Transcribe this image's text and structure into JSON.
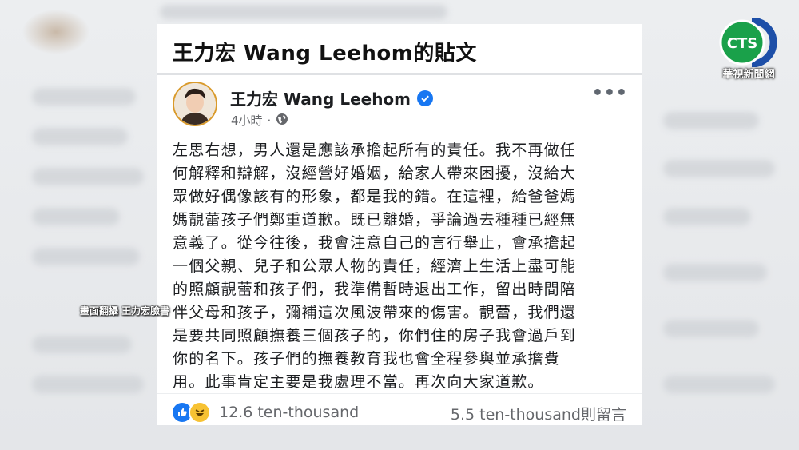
{
  "card": {
    "title": "王力宏 Wang Leehom的貼文"
  },
  "post": {
    "author": "王力宏 Wang Leehom",
    "time": "4小時",
    "separator": "·",
    "body": "左思右想，男人還是應該承擔起所有的責任。我不再做任\n何解釋和辯解，沒經營好婚姻，給家人帶來困擾，沒給大\n眾做好偶像該有的形象，都是我的錯。在這裡，給爸爸媽\n媽靚蕾孩子們鄭重道歉。既已離婚，爭論過去種種已經無\n意義了。從今往後，我會注意自己的言行舉止，會承擔起\n一個父親、兒子和公眾人物的責任，經濟上生活上盡可能\n的照顧靚蕾和孩子們，我準備暫時退出工作，留出時間陪\n伴父母和孩子，彌補這次風波帶來的傷害。靚蕾，我們還\n是要共同照顧撫養三個孩子的，你們住的房子我會過戶到\n你的名下。孩子們的撫養教育我也會全程參與並承擔費\n用。此事肯定主要是我處理不當。再次向大家道歉。",
    "reactions_count": "12.6 ten-thousand",
    "comments_count": "5.5 ten-thousand則留言"
  },
  "overlay": {
    "caption": "畫面翻攝 王力宏臉書",
    "logo_text": "CTS",
    "logo_sub": "華視新聞網"
  },
  "colors": {
    "fb_blue": "#1877f2",
    "cts_green": "#1aa14a",
    "cts_blue": "#1d4fa8"
  }
}
